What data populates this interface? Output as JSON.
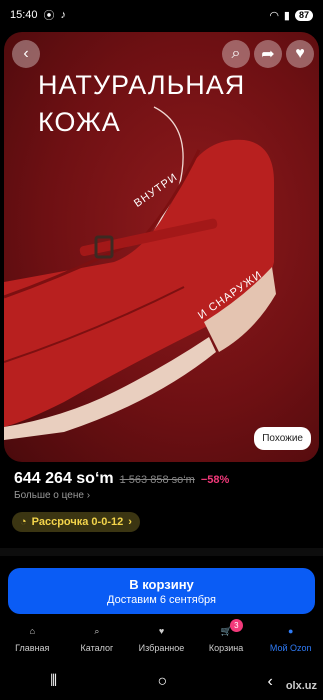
{
  "status_bar": {
    "time": "15:40",
    "battery": "87"
  },
  "photo": {
    "title_line1": "НАТУРАЛЬНАЯ",
    "title_line2": "КОЖА",
    "label_inside": "ВНУТРИ",
    "label_outside": "И СНАРУЖИ",
    "similar_button": "Похожие"
  },
  "product": {
    "price": "644 264 so‘m",
    "old_price": "1 563 858 so‘m",
    "discount": "−58%",
    "more_about_price": "Больше о цене",
    "installment": "Рассрочка 0-0-12"
  },
  "cart_button": {
    "label": "В корзину",
    "delivery": "Доставим 6 сентября"
  },
  "nav": {
    "items": [
      {
        "label": "Главная",
        "icon": "home-icon"
      },
      {
        "label": "Каталог",
        "icon": "search-icon"
      },
      {
        "label": "Избранное",
        "icon": "heart-icon"
      },
      {
        "label": "Корзина",
        "icon": "cart-icon",
        "badge": "3"
      },
      {
        "label": "Мой Ozon",
        "icon": "profile-icon"
      }
    ]
  },
  "watermark": "olx.uz",
  "colors": {
    "accent": "#0a5cf5",
    "discount": "#f2397a",
    "installment": "#f3d44b"
  }
}
